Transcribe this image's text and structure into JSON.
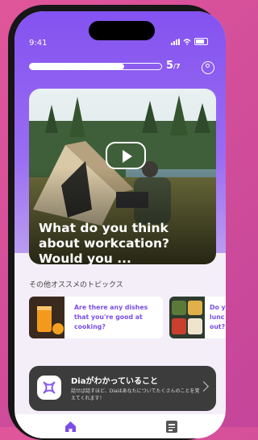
{
  "status_bar": {
    "time": "9:41"
  },
  "progress": {
    "current": "5",
    "total": "/7",
    "fraction": 0.72
  },
  "hero": {
    "title": "What do you think about workcation?  Would you ..."
  },
  "section": {
    "title": "その他オススメのトピックス"
  },
  "topics": [
    {
      "text": "Are there any dishes that you're good at cooking?"
    },
    {
      "text": "Do y lunc out?"
    }
  ],
  "dia_card": {
    "title": "Diaがわかっていること",
    "subtitle": "話せば話すほど、Diaはあなたについてたくさんのことを覚えてくれます！"
  },
  "colors": {
    "accent": "#8452f0",
    "topic_text": "#7a4ee8"
  },
  "nav": {
    "items": [
      "home-icon",
      "notes-icon"
    ]
  }
}
